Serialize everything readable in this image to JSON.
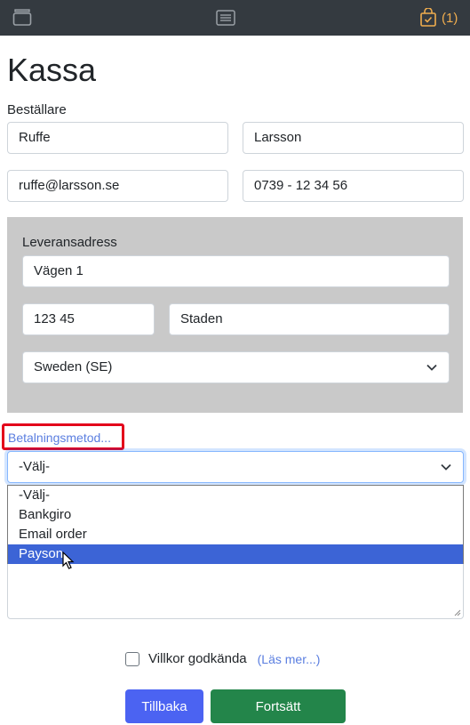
{
  "header": {
    "cart_count": "(1)"
  },
  "page": {
    "title": "Kassa"
  },
  "buyer": {
    "label": "Beställare",
    "first_name": "Ruffe",
    "last_name": "Larsson",
    "email": "ruffe@larsson.se",
    "phone": "0739 - 12 34 56"
  },
  "delivery": {
    "label": "Leveransadress",
    "street": "Vägen 1",
    "zip": "123 45",
    "city": "Staden",
    "country": "Sweden (SE)"
  },
  "payment": {
    "label": "Betalningsmetod...",
    "selected": "-Välj-",
    "options": [
      "-Välj-",
      "Bankgiro",
      "Email order",
      "Payson"
    ],
    "highlighted_option": "Payson"
  },
  "terms": {
    "label": "Villkor godkända",
    "read_more": "(Läs mer...)"
  },
  "buttons": {
    "back": "Tillbaka",
    "next": "Fortsätt"
  },
  "colors": {
    "topbar": "#343a40",
    "cart_accent": "#f0ad4e",
    "primary": "#4b63f2",
    "success": "#23854a",
    "highlight_frame": "#e3001b",
    "delivery_panel": "#c9c9c9"
  },
  "icons": {
    "left": "archive-icon",
    "center": "list-icon",
    "cart": "shopping-bag-check-icon",
    "cursor": "mouse-cursor-icon"
  }
}
